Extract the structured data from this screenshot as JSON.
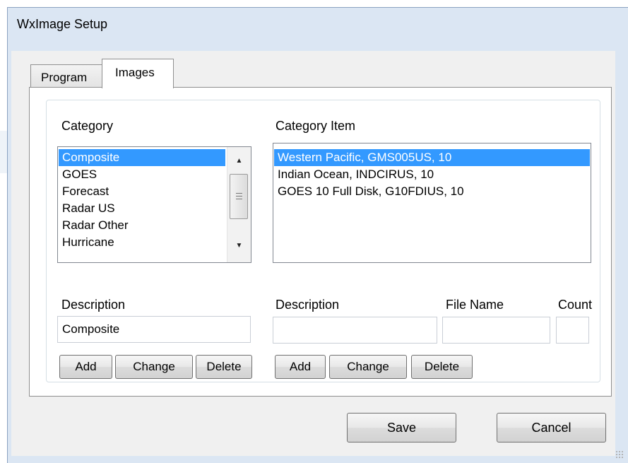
{
  "window": {
    "title": "WxImage Setup"
  },
  "tabs": [
    {
      "label": "Program"
    },
    {
      "label": "Images"
    }
  ],
  "category": {
    "heading": "Category",
    "items": [
      "Composite",
      "GOES",
      "Forecast",
      "Radar US",
      "Radar Other",
      "Hurricane"
    ],
    "selected_index": 0,
    "description_label": "Description",
    "description_value": "Composite",
    "add_label": "Add",
    "change_label": "Change",
    "delete_label": "Delete"
  },
  "category_item": {
    "heading": "Category Item",
    "items": [
      "Western Pacific, GMS005US, 10",
      "Indian Ocean, INDCIRUS, 10",
      "GOES 10 Full Disk, G10FDIUS, 10"
    ],
    "selected_index": 0,
    "description_label": "Description",
    "file_name_label": "File Name",
    "count_label": "Count",
    "description_value": "",
    "file_name_value": "",
    "count_value": "",
    "add_label": "Add",
    "change_label": "Change",
    "delete_label": "Delete"
  },
  "footer": {
    "save_label": "Save",
    "cancel_label": "Cancel"
  },
  "colors": {
    "selection": "#3399ff",
    "frame": "#dbe6f3"
  }
}
